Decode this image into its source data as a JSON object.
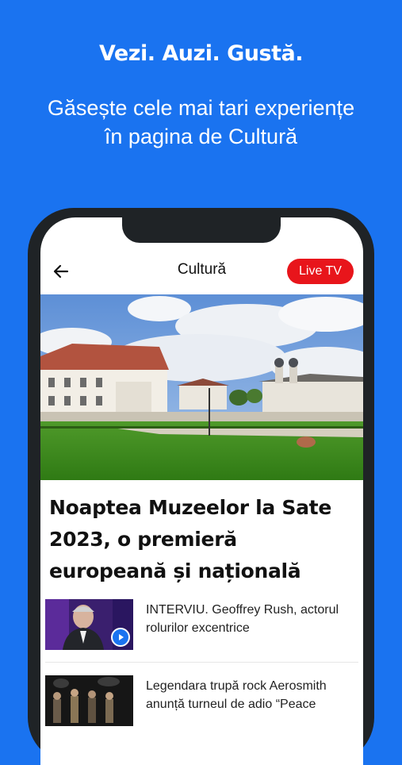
{
  "promo": {
    "tagline": "Vezi. Auzi. Gustă.",
    "subtitle_line1": "Găsește cele mai tari experiențe",
    "subtitle_line2": "în pagina de Cultură"
  },
  "app": {
    "title": "Cultură",
    "live_label": "Live TV",
    "back_icon": "arrow-left-icon"
  },
  "featured": {
    "image_icon": "museum-photo",
    "headline": "Noaptea Muzeelor la Sate 2023, o premieră europeană și națională"
  },
  "articles": [
    {
      "title": "INTERVIU. Geoffrey Rush, actorul rolurilor excentrice",
      "has_video": true
    },
    {
      "title": "Legendara trupă rock Aerosmith anunță turneul de adio “Peace",
      "has_video": false
    }
  ],
  "colors": {
    "background": "#1a73f0",
    "live": "#e8151b",
    "phone_frame": "#1f2326"
  }
}
